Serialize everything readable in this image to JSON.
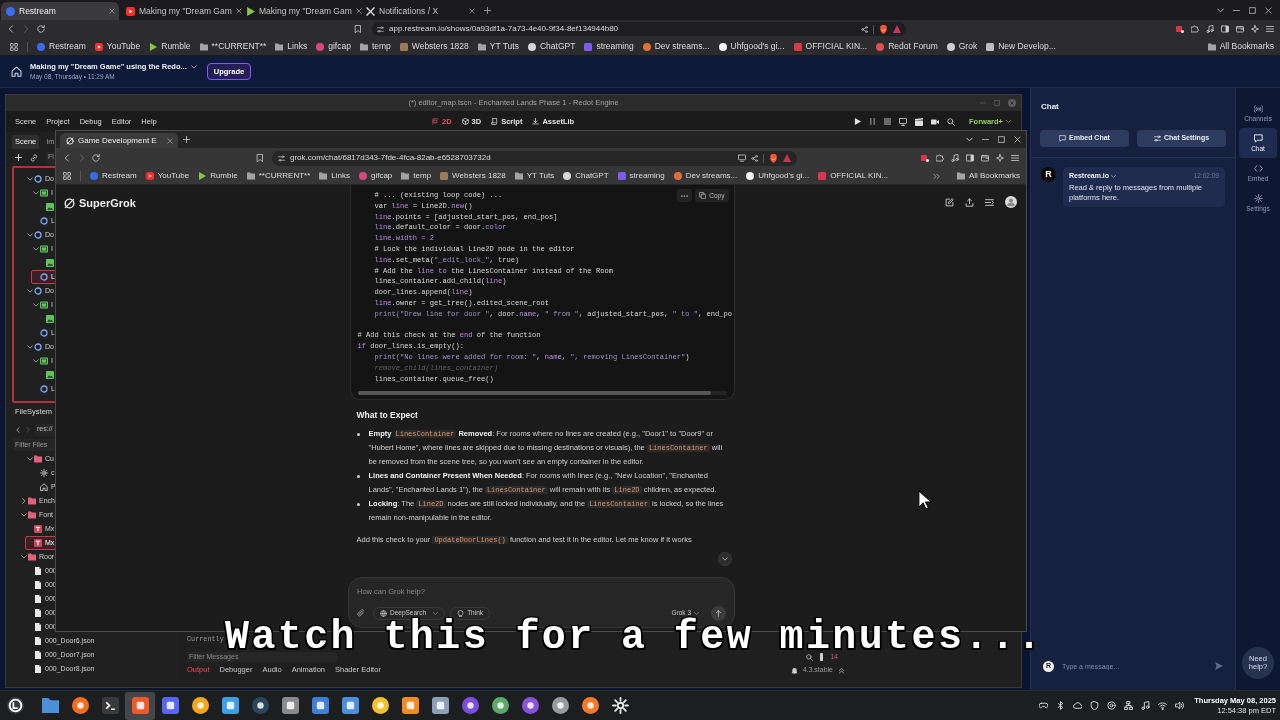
{
  "browser": {
    "tabs": [
      {
        "title": "Restream",
        "kind": "disc",
        "color": "#3b6cf0",
        "selected": true
      },
      {
        "title": "Making my \"Dream Gam",
        "kind": "playbox",
        "color": "#ff2a2a",
        "selected": false
      },
      {
        "title": "Making my \"Dream Gam",
        "kind": "play",
        "color": "#85c742",
        "selected": false
      },
      {
        "title": "Notifications / X",
        "kind": "x",
        "color": "#e8e8e8",
        "selected": false
      }
    ],
    "forward_disabled": true,
    "url": "app.restream.io/shows/0a93df1a-7a73-4e40-9f34-8ef134944b80",
    "bookmarks": [
      {
        "label": "Restream",
        "kind": "disc",
        "color": "#3b6cf0"
      },
      {
        "label": "YouTube",
        "kind": "playbox",
        "color": "#ff2a2a"
      },
      {
        "label": "Rumble",
        "kind": "play",
        "color": "#85c742"
      },
      {
        "label": "**CURRENT**",
        "kind": "folder"
      },
      {
        "label": "Links",
        "kind": "folder"
      },
      {
        "label": "gifcap",
        "kind": "disc",
        "color": "#d9487d"
      },
      {
        "label": "temp",
        "kind": "folder"
      },
      {
        "label": "Websters 1828",
        "kind": "square",
        "color": "#9c7b58"
      },
      {
        "label": "YT Tuts",
        "kind": "folder"
      },
      {
        "label": "ChatGPT",
        "kind": "disc",
        "color": "#d6d6d6"
      },
      {
        "label": "streaming",
        "kind": "square",
        "color": "#7b5cf0"
      },
      {
        "label": "Dev streams...",
        "kind": "disc",
        "color": "#e0703a"
      },
      {
        "label": "Uhfgood's gi...",
        "kind": "disc",
        "color": "#f2f2f2"
      },
      {
        "label": "OFFICIAL KIN...",
        "kind": "square",
        "color": "#d33a4a"
      },
      {
        "label": "Redot Forum",
        "kind": "disc",
        "color": "#e05050"
      },
      {
        "label": "Grok",
        "kind": "disc",
        "color": "#cfcfcf"
      },
      {
        "label": "New Develop...",
        "kind": "square",
        "color": "#bdbdbd"
      }
    ],
    "all_bookmarks": "All Bookmarks"
  },
  "show_header": {
    "title": "Making my \"Dream Game\" using the Redo...",
    "subtitle": "May 08, Thursday • 11:29 AM",
    "upgrade": "Upgrade"
  },
  "editor": {
    "title": "(*) editor_map.tscn - Enchanted Lands Phase 1 - Redot Engine",
    "menus": [
      "Scene",
      "Project",
      "Debug",
      "Editor",
      "Help"
    ],
    "workspaces": [
      {
        "label": "2D",
        "kind": "plane",
        "selected": true
      },
      {
        "label": "3D",
        "kind": "cube",
        "selected": false
      },
      {
        "label": "Script",
        "kind": "script",
        "selected": false
      },
      {
        "label": "AssetLib",
        "kind": "download",
        "selected": false
      }
    ],
    "renderer": "Forward+",
    "dock_tabs": [
      {
        "label": "Scene",
        "selected": true
      },
      {
        "label": "Im",
        "selected": false
      }
    ],
    "scene_filter_placeholder": "Fi",
    "scene_tree": [
      {
        "label": "Do",
        "kind": "node",
        "expanded": true,
        "selected": false,
        "children": [
          {
            "label": "I",
            "kind": "rect",
            "expanded": true,
            "selected": false,
            "children": [
              {
                "kind": "sprite",
                "selected": false
              }
            ]
          },
          {
            "label": "L",
            "kind": "node",
            "selected": false
          }
        ]
      },
      {
        "label": "Do",
        "kind": "node",
        "expanded": true,
        "selected": false,
        "children": [
          {
            "label": "I",
            "kind": "rect",
            "expanded": true,
            "selected": false,
            "children": [
              {
                "kind": "sprite",
                "selected": false
              }
            ]
          },
          {
            "label": "L",
            "kind": "node",
            "selected": true
          }
        ]
      },
      {
        "label": "Do",
        "kind": "node",
        "expanded": true,
        "selected": false,
        "children": [
          {
            "label": "I",
            "kind": "rect",
            "expanded": true,
            "selected": false,
            "children": [
              {
                "kind": "sprite",
                "selected": false
              }
            ]
          },
          {
            "label": "L",
            "kind": "node",
            "selected": false
          }
        ]
      },
      {
        "label": "Do",
        "kind": "node",
        "expanded": true,
        "selected": false,
        "children": [
          {
            "label": "I",
            "kind": "rect",
            "expanded": true,
            "selected": false,
            "children": [
              {
                "kind": "sprite",
                "selected": false
              }
            ]
          },
          {
            "label": "L",
            "kind": "node",
            "selected": false
          }
        ]
      }
    ],
    "filesystem": {
      "title": "FileSystem",
      "path": "res://",
      "filter_placeholder": "Filter Files",
      "tree": [
        {
          "children": [
            {
              "label": "Cu",
              "kind": "folder",
              "expanded": true,
              "selected": false,
              "children": [
                {
                  "label": "c",
                  "kind": "gear",
                  "selected": false
                },
                {
                  "label": "P",
                  "kind": "house",
                  "selected": false
                }
              ]
            }
          ]
        },
        {
          "label": "Ench",
          "kind": "folder",
          "expanded": false,
          "selected": false
        },
        {
          "label": "Font",
          "kind": "folder",
          "expanded": true,
          "selected": false,
          "children": [
            {
              "label": "Mx",
              "kind": "font",
              "selected": false
            },
            {
              "label": "Mx",
              "kind": "font",
              "selected": true
            }
          ]
        },
        {
          "label": "Roor",
          "kind": "folder",
          "expanded": true,
          "selected": false,
          "children": [
            {
              "label": "000",
              "kind": "file",
              "selected": false
            },
            {
              "label": "000",
              "kind": "file",
              "selected": false
            },
            {
              "label": "000",
              "kind": "file",
              "selected": false
            },
            {
              "label": "000",
              "kind": "file",
              "selected": false
            },
            {
              "label": "000",
              "kind": "file",
              "selected": false
            },
            {
              "label": "000_Door6.json",
              "kind": "file",
              "selected": false
            },
            {
              "label": "000_Door7.json",
              "kind": "file",
              "selected": false
            },
            {
              "label": "000_Door8.json",
              "kind": "file",
              "selected": false
            }
          ]
        }
      ]
    },
    "bottom_panel": {
      "output_line": "Currently",
      "filter_placeholder": "Filter Messages",
      "count": "14",
      "tabs": [
        {
          "label": "Output",
          "selected": true
        },
        {
          "label": "Debugger",
          "selected": false
        },
        {
          "label": "Audio",
          "selected": false
        },
        {
          "label": "Animation",
          "selected": false
        },
        {
          "label": "Shader Editor",
          "selected": false
        }
      ],
      "version": "4.3.stable"
    }
  },
  "inner_browser": {
    "tab": {
      "title": "Game Development E",
      "selected": true
    },
    "url": "grok.com/chat/6817d343-7fde-4fca-82ab-e6528703732d",
    "bookmarks": [
      {
        "label": "Restream",
        "kind": "disc",
        "color": "#3b6cf0"
      },
      {
        "label": "YouTube",
        "kind": "playbox",
        "color": "#ff2a2a"
      },
      {
        "label": "Rumble",
        "kind": "play",
        "color": "#85c742"
      },
      {
        "label": "**CURRENT**",
        "kind": "folder"
      },
      {
        "label": "Links",
        "kind": "folder"
      },
      {
        "label": "gifcap",
        "kind": "disc",
        "color": "#d9487d"
      },
      {
        "label": "temp",
        "kind": "folder"
      },
      {
        "label": "Websters 1828",
        "kind": "square",
        "color": "#9c7b58"
      },
      {
        "label": "YT Tuts",
        "kind": "folder"
      },
      {
        "label": "ChatGPT",
        "kind": "disc",
        "color": "#d6d6d6"
      },
      {
        "label": "streaming",
        "kind": "square",
        "color": "#7b5cf0"
      },
      {
        "label": "Dev streams...",
        "kind": "disc",
        "color": "#e0703a"
      },
      {
        "label": "Uhfgood's gi...",
        "kind": "disc",
        "color": "#f2f2f2"
      },
      {
        "label": "OFFICIAL KIN...",
        "kind": "square",
        "color": "#d33a4a"
      }
    ],
    "all_bookmarks": "All Bookmarks"
  },
  "grok": {
    "logo": "SuperGrok",
    "copy_label": "Copy",
    "code_lines": [
      {
        "indent": true,
        "segments": [
          {
            "kind": "plain",
            "text": "# ... (existing loop code) ..."
          }
        ]
      },
      {
        "indent": true,
        "segments": [
          {
            "kind": "plain",
            "text": "var "
          },
          {
            "kind": "kw",
            "text": "line"
          },
          {
            "kind": "plain",
            "text": " = Line2D."
          },
          {
            "kind": "kw",
            "text": "new"
          },
          {
            "kind": "plain",
            "text": "()"
          }
        ]
      },
      {
        "indent": true,
        "segments": [
          {
            "kind": "kw",
            "text": "line"
          },
          {
            "kind": "plain",
            "text": ".points = [adjusted_start_pos, end_pos]"
          }
        ]
      },
      {
        "indent": true,
        "segments": [
          {
            "kind": "kw",
            "text": "line"
          },
          {
            "kind": "plain",
            "text": ".default_color = door."
          },
          {
            "kind": "kw",
            "text": "color"
          }
        ]
      },
      {
        "indent": true,
        "segments": [
          {
            "kind": "kw",
            "text": "line.width = 2"
          }
        ]
      },
      {
        "indent": true,
        "segments": [
          {
            "kind": "plain",
            "text": "# Lock the individual Line2D node in the editor"
          }
        ]
      },
      {
        "indent": true,
        "segments": [
          {
            "kind": "kw",
            "text": "line"
          },
          {
            "kind": "plain",
            "text": ".set_meta("
          },
          {
            "kind": "str",
            "text": "\"_edit_lock_\""
          },
          {
            "kind": "plain",
            "text": ", true)"
          }
        ]
      },
      {
        "indent": true,
        "segments": [
          {
            "kind": "plain",
            "text": "# Add the "
          },
          {
            "kind": "kw",
            "text": "line to"
          },
          {
            "kind": "plain",
            "text": " the LinesContainer instead of the Room"
          }
        ]
      },
      {
        "indent": true,
        "segments": [
          {
            "kind": "plain",
            "text": "lines_container.add_child("
          },
          {
            "kind": "kw",
            "text": "line"
          },
          {
            "kind": "plain",
            "text": ")"
          }
        ]
      },
      {
        "indent": true,
        "segments": [
          {
            "kind": "plain",
            "text": "door_lines.append("
          },
          {
            "kind": "kw",
            "text": "line"
          },
          {
            "kind": "plain",
            "text": ")"
          }
        ]
      },
      {
        "indent": true,
        "segments": [
          {
            "kind": "kw",
            "text": "line"
          },
          {
            "kind": "plain",
            "text": ".owner = get_tree().edited_scene_root"
          }
        ]
      },
      {
        "indent": true,
        "segments": [
          {
            "kind": "str",
            "text": "print(\"Drew line for door \""
          },
          {
            "kind": "plain",
            "text": ", door."
          },
          {
            "kind": "kw",
            "text": "name"
          },
          {
            "kind": "plain",
            "text": ", "
          },
          {
            "kind": "str",
            "text": "\" from \""
          },
          {
            "kind": "plain",
            "text": ", adjusted_start_pos, "
          },
          {
            "kind": "str",
            "text": "\" to \""
          },
          {
            "kind": "plain",
            "text": ", end_po"
          }
        ]
      },
      {
        "gap_before": true,
        "segments": [
          {
            "kind": "plain",
            "text": "# Add this check at the "
          },
          {
            "kind": "kw",
            "text": "end"
          },
          {
            "kind": "plain",
            "text": " of the function"
          }
        ]
      },
      {
        "segments": [
          {
            "kind": "kw",
            "text": "if"
          },
          {
            "kind": "plain",
            "text": " door_lines.is_empty():"
          }
        ]
      },
      {
        "indent": true,
        "segments": [
          {
            "kind": "str",
            "text": "print(\"No lines were added for room: \""
          },
          {
            "kind": "plain",
            "text": ", "
          },
          {
            "kind": "kw",
            "text": "name"
          },
          {
            "kind": "plain",
            "text": ", "
          },
          {
            "kind": "str",
            "text": "\", removing LinesContainer\""
          },
          {
            "kind": "plain",
            "text": ")"
          }
        ]
      },
      {
        "indent": true,
        "segments": [
          {
            "kind": "muted",
            "text": "remove_child(lines_container)"
          }
        ]
      },
      {
        "indent": true,
        "segments": [
          {
            "kind": "plain",
            "text": "lines_container.queue_free()"
          }
        ]
      }
    ],
    "heading": "What to Expect",
    "bullets": [
      [
        {
          "kind": "bold",
          "text": "Empty "
        },
        {
          "kind": "code",
          "text": "LinesContainer"
        },
        {
          "kind": "bold",
          "text": " Removed"
        },
        {
          "kind": "text",
          "text": ": For rooms where no lines are created (e.g., \"Door1\" to \"Door9\" or \"Hubert Home\", where lines are skipped due to missing destinations or visuals), the "
        },
        {
          "kind": "code",
          "text": "LinesContainer"
        },
        {
          "kind": "text",
          "text": " will be removed from the scene tree, so you won’t see an empty container in the editor."
        }
      ],
      [
        {
          "kind": "bold",
          "text": "Lines and Container Present When Needed"
        },
        {
          "kind": "text",
          "text": ": For rooms with lines (e.g., \"New Location\", \"Enchanted Lands\", \"Enchanted Lands 1\"), the "
        },
        {
          "kind": "code",
          "text": "LinesContainer"
        },
        {
          "kind": "text",
          "text": " will remain with its "
        },
        {
          "kind": "code",
          "text": "Line2D"
        },
        {
          "kind": "text",
          "text": " children, as expected."
        }
      ],
      [
        {
          "kind": "bold",
          "text": "Locking"
        },
        {
          "kind": "text",
          "text": ": The "
        },
        {
          "kind": "code",
          "text": "Line2D"
        },
        {
          "kind": "text",
          "text": " nodes are still locked individually, and the "
        },
        {
          "kind": "code",
          "text": "LinesContainer"
        },
        {
          "kind": "text",
          "text": " is locked, so the lines remain non-manipulable in the editor."
        }
      ]
    ],
    "closing": [
      {
        "kind": "text",
        "text": "Add this check to your "
      },
      {
        "kind": "code",
        "text": "UpdateDoorLines()"
      },
      {
        "kind": "text",
        "text": " function and test it in the editor. Let me know if it works"
      }
    ],
    "composer": {
      "placeholder": "How can Grok help?",
      "tools": [
        {
          "label": "DeepSearch",
          "kind": "globe",
          "has_menu": true
        },
        {
          "label": "Think",
          "kind": "bulb",
          "has_menu": false
        }
      ],
      "model": "Grok 3"
    }
  },
  "chat": {
    "title": "Chat",
    "buttons": [
      {
        "label": "Embed Chat",
        "kind": "embed"
      },
      {
        "label": "Chat Settings",
        "kind": "settings"
      }
    ],
    "messages": [
      {
        "avatar": "R",
        "author": "Restream.io",
        "time": "12:02:09",
        "text": "Read & reply to messages from multiple platforms here."
      }
    ],
    "composer": {
      "avatar": "R",
      "placeholder": "Type a message..."
    }
  },
  "sidebar": {
    "items": [
      {
        "label": "Channels",
        "kind": "broadcast",
        "selected": false
      },
      {
        "label": "Chat",
        "kind": "chat",
        "selected": true
      },
      {
        "label": "Embed",
        "kind": "code",
        "selected": false
      },
      {
        "label": "Settings",
        "kind": "gear",
        "selected": false
      }
    ],
    "help": "Need help?"
  },
  "taskbar": {
    "apps": [
      {
        "kind": "start",
        "selected": false
      },
      {
        "kind": "folder",
        "color": "#4a90d9",
        "selected": false
      },
      {
        "kind": "disc",
        "color": "#f36d21",
        "selected": false
      },
      {
        "kind": "terminal",
        "color": "#3a3a3a",
        "selected": false
      },
      {
        "kind": "tile",
        "color": "#f05a28",
        "selected": true
      },
      {
        "kind": "tile",
        "color": "#5865f2",
        "selected": false
      },
      {
        "kind": "disc",
        "color": "#f7a51c",
        "selected": false
      },
      {
        "kind": "tile",
        "color": "#3ca0e6",
        "selected": false
      },
      {
        "kind": "disc",
        "color": "#2a475e",
        "selected": false
      },
      {
        "kind": "tile",
        "color": "#8a8a8a",
        "selected": false
      },
      {
        "kind": "tile",
        "color": "#3f7fd8",
        "selected": false
      },
      {
        "kind": "tile",
        "color": "#4a8fe0",
        "selected": false
      },
      {
        "kind": "disc",
        "color": "#f2c12e",
        "selected": false
      },
      {
        "kind": "tile",
        "color": "#f28b20",
        "selected": false
      },
      {
        "kind": "tile",
        "color": "#8aa0b8",
        "selected": false
      },
      {
        "kind": "disc",
        "color": "#7a4de0",
        "selected": false
      },
      {
        "kind": "disc",
        "color": "#5aa86a",
        "selected": false
      },
      {
        "kind": "disc",
        "color": "#8a52d8",
        "selected": false
      },
      {
        "kind": "disc",
        "color": "#9a9a9a",
        "selected": false
      },
      {
        "kind": "disc",
        "color": "#f5792a",
        "selected": false
      },
      {
        "kind": "gear",
        "color": "#e6e6e6",
        "selected": false
      }
    ],
    "date": "Thursday May 08, 2025",
    "time": "12:54:38 pm EDT"
  },
  "caption": "Watch this for a few minutes..."
}
